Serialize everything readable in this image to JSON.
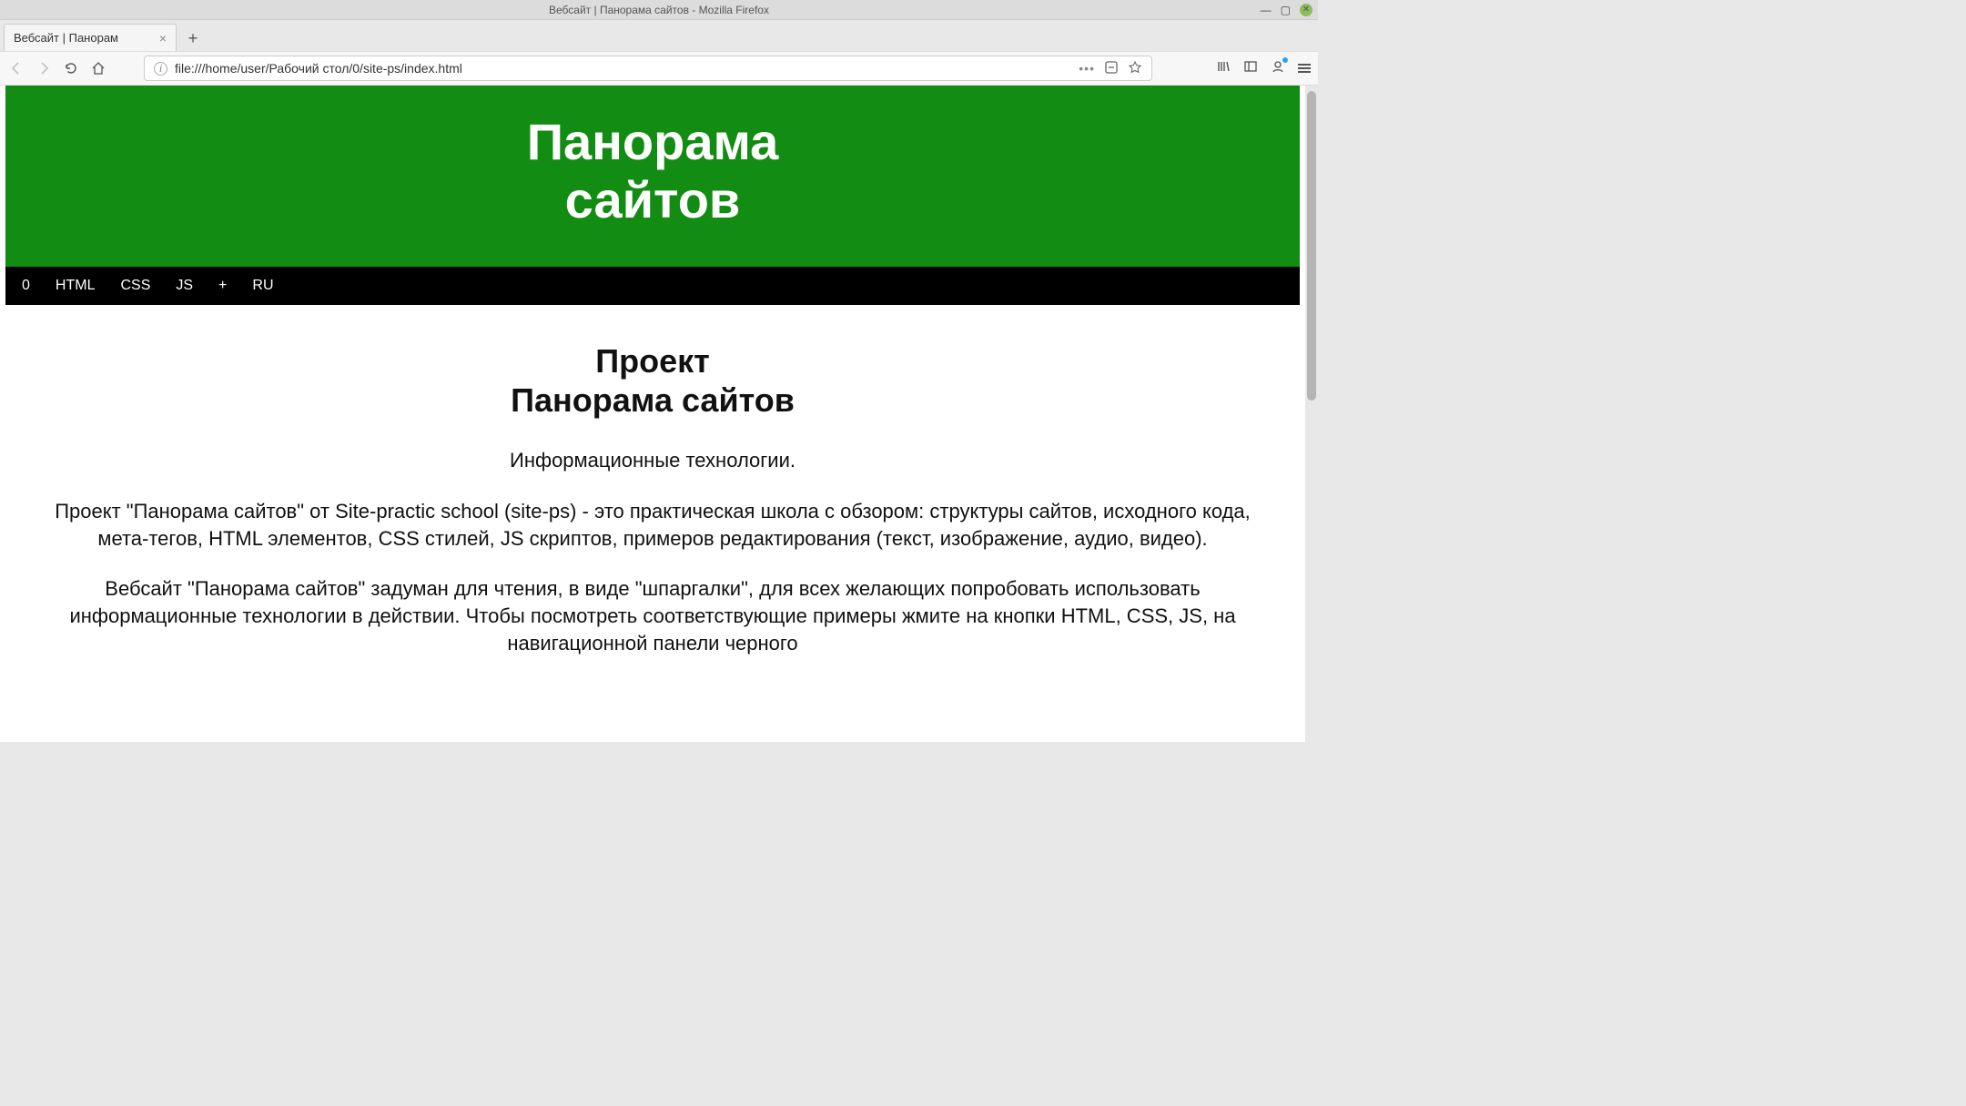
{
  "os": {
    "window_title": "Вебсайт | Панорама сайтов - Mozilla Firefox"
  },
  "browser": {
    "tab_title": "Вебсайт | Панорам",
    "tab_close": "×",
    "newtab_label": "+",
    "url": "file:///home/user/Рабочий стол/0/site-ps/index.html",
    "url_more": "•••"
  },
  "page": {
    "header": {
      "title_line1": "Панорама",
      "title_line2": "сайтов"
    },
    "nav": {
      "items": [
        "0",
        "HTML",
        "CSS",
        "JS",
        "+",
        "RU"
      ]
    },
    "content": {
      "h2_line1": "Проект",
      "h2_line2": "Панорама сайтов",
      "p1": "Информационные технологии.",
      "p2": "Проект \"Панорама сайтов\" от Site-practic school (site-ps) - это практическая школа с обзором: структуры сайтов, исходного кода, мета-тегов, HTML элементов, CSS стилей, JS скриптов, примеров редактирования (текст, изображение, аудио, видео).",
      "p3": "Вебсайт \"Панорама сайтов\" задуман для чтения, в виде \"шпаргалки\", для всех желающих попробовать использовать информационные технологии в действии. Чтобы посмотреть соответствующие примеры жмите на кнопки HTML, CSS, JS, на навигационной панели черного"
    }
  }
}
